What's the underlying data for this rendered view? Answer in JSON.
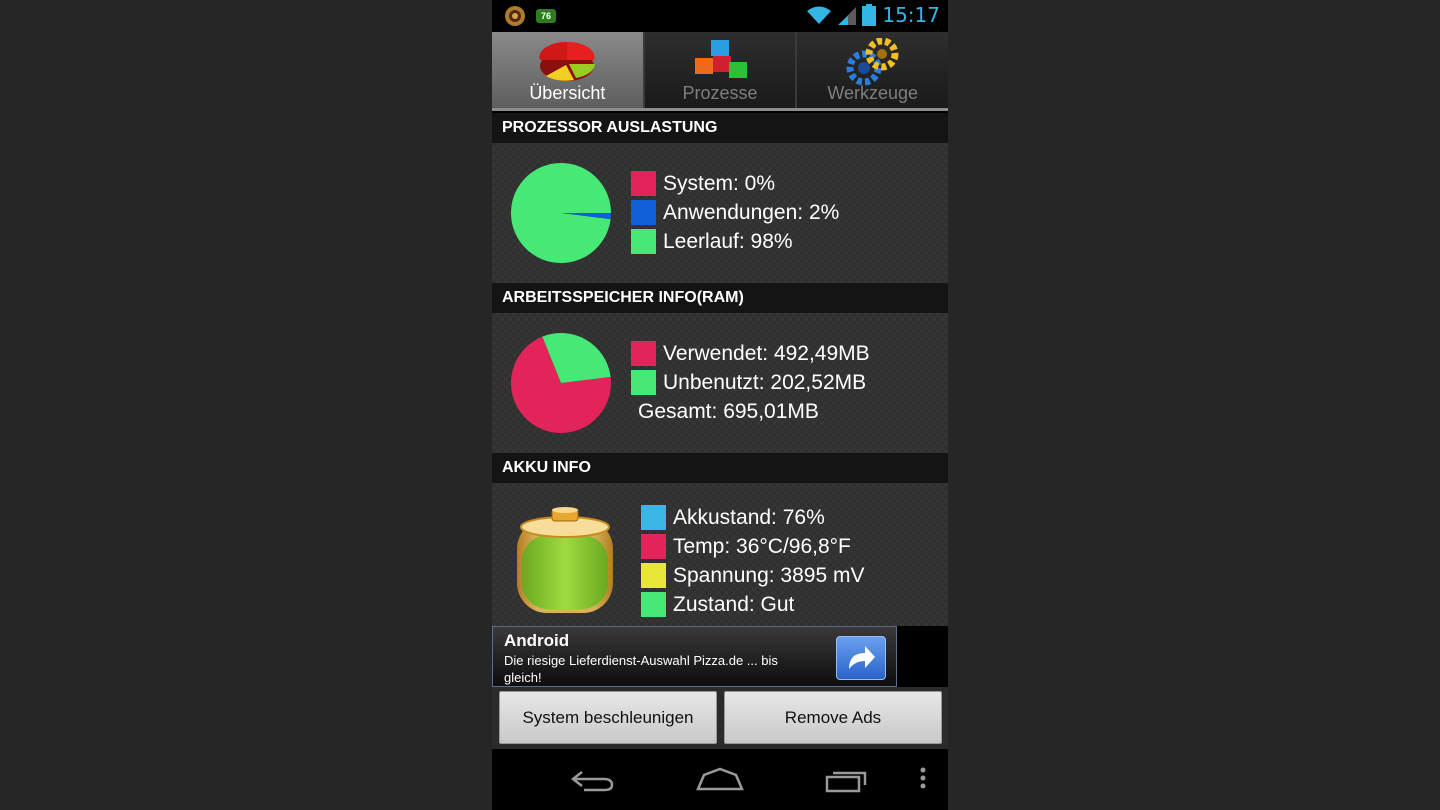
{
  "statusbar": {
    "time": "15:17",
    "battery_badge": "76"
  },
  "tabs": [
    {
      "label": "Übersicht",
      "icon": "pie-chart-icon",
      "active": true
    },
    {
      "label": "Prozesse",
      "icon": "cubes-icon",
      "active": false
    },
    {
      "label": "Werkzeuge",
      "icon": "gears-icon",
      "active": false
    }
  ],
  "cpu": {
    "title": "PROZESSOR AUSLASTUNG",
    "legend": [
      {
        "label": "System: 0%",
        "color": "#e3245a",
        "percent": 0
      },
      {
        "label": "Anwendungen: 2%",
        "color": "#0f5fd8",
        "percent": 2
      },
      {
        "label": "Leerlauf: 98%",
        "color": "#46e876",
        "percent": 98
      }
    ]
  },
  "ram": {
    "title": "ARBEITSSPEICHER INFO(RAM)",
    "legend": [
      {
        "label": "Verwendet: 492,49MB",
        "color": "#e3245a",
        "value": 492.49
      },
      {
        "label": "Unbenutzt: 202,52MB",
        "color": "#46e876",
        "value": 202.52
      }
    ],
    "total": "Gesamt: 695,01MB"
  },
  "battery": {
    "title": "AKKU INFO",
    "level_percent": 76,
    "legend": [
      {
        "label": "Akkustand: 76%",
        "color": "#3cb4e6"
      },
      {
        "label": "Temp: 36°C/96,8°F",
        "color": "#e3245a"
      },
      {
        "label": "Spannung: 3895 mV",
        "color": "#e9e63a"
      },
      {
        "label": "Zustand: Gut",
        "color": "#46e876"
      }
    ]
  },
  "ad": {
    "title": "Android",
    "text": "Die riesige Lieferdienst-Auswahl Pizza.de ... bis gleich!"
  },
  "buttons": {
    "speed_up": "System beschleunigen",
    "remove_ads": "Remove Ads"
  }
}
